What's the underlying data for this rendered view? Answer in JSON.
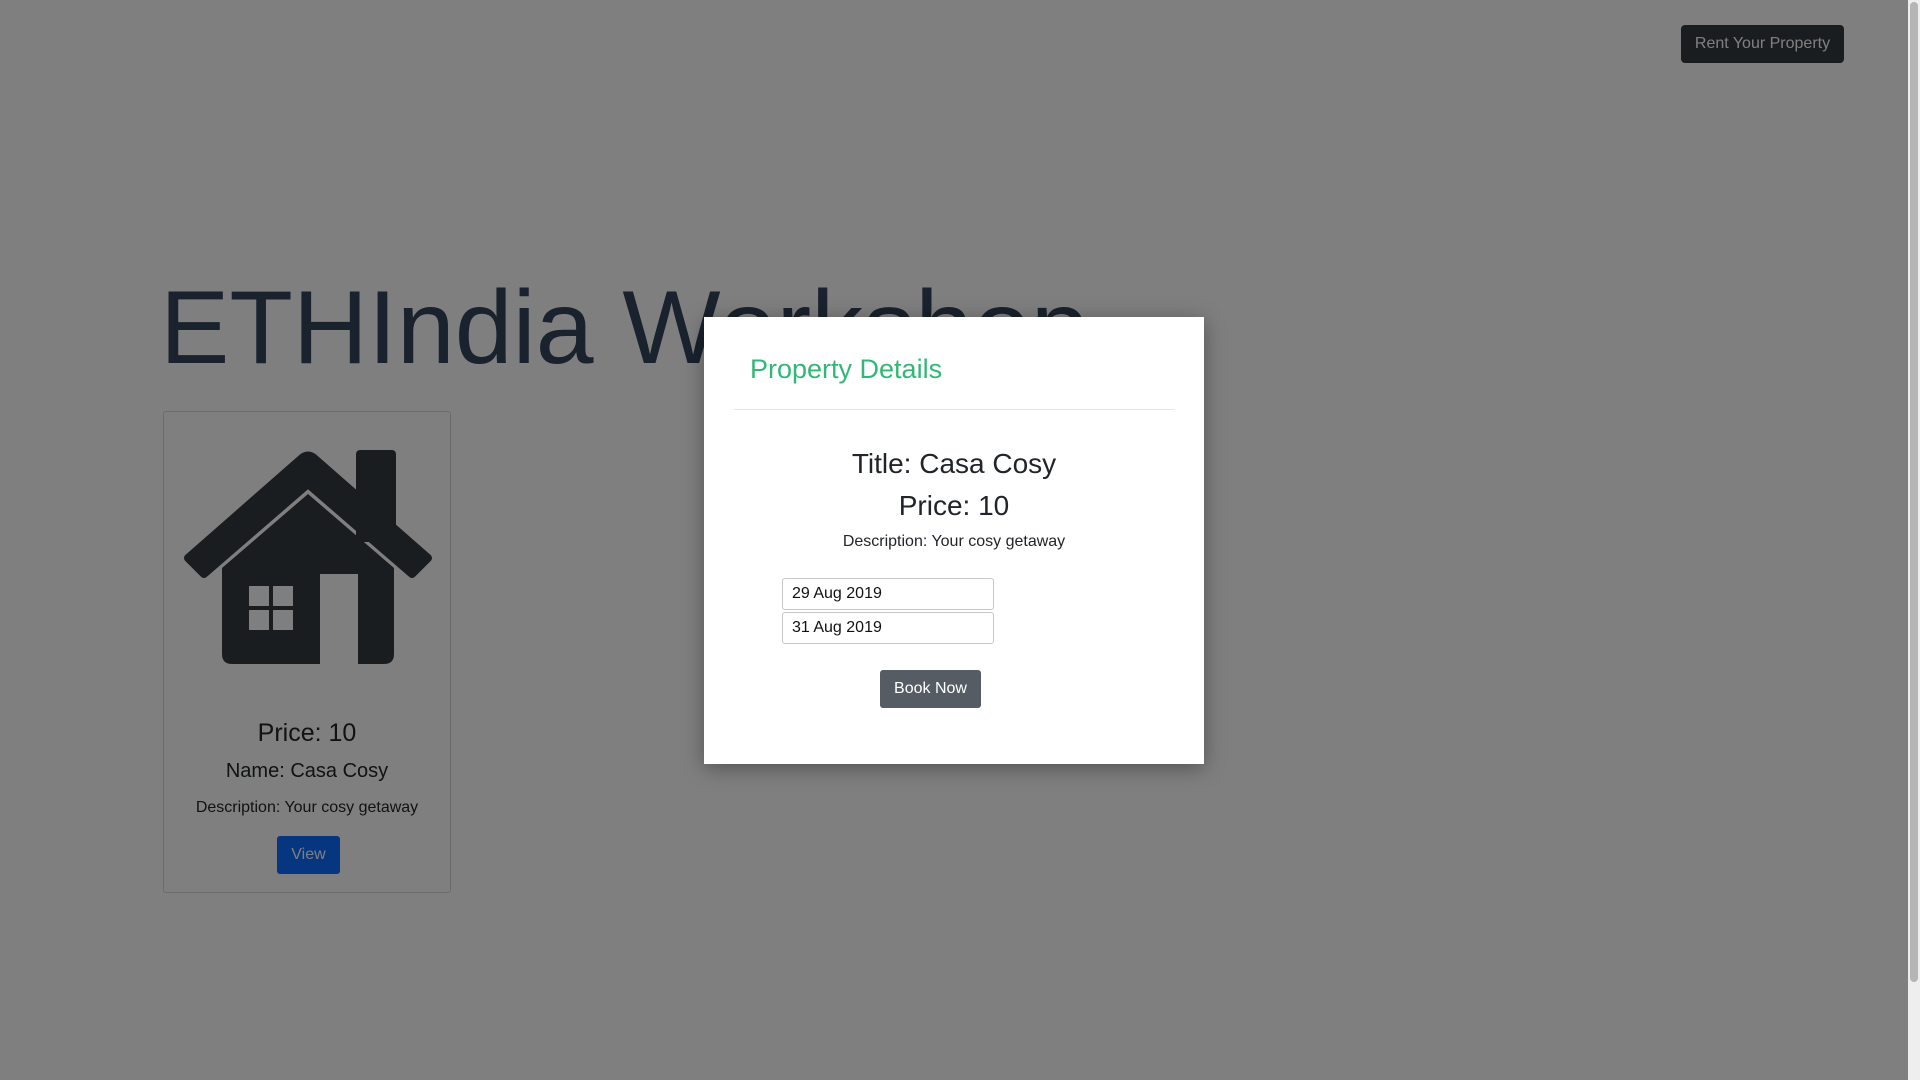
{
  "header": {
    "rent_button_label": "Rent Your Property"
  },
  "hero": {
    "title": "ETHIndia Workshop"
  },
  "listing_card": {
    "icon": "house-icon",
    "price_label": "Price: ",
    "price": "10",
    "name_label": "Name: ",
    "name": "Casa Cosy",
    "description_label": "Description: ",
    "description": "Your cosy getaway",
    "view_button_label": "View"
  },
  "modal": {
    "title": "Property Details",
    "title_label": "Title: ",
    "property_title": "Casa Cosy",
    "price_label": "Price: ",
    "price": "10",
    "description_label": "Description: ",
    "description": "Your cosy getaway",
    "start_date": "29 Aug 2019",
    "end_date": "31 Aug 2019",
    "book_button_label": "Book Now"
  },
  "colors": {
    "overlay": "rgba(0,0,0,0.5)",
    "modal_title": "#33b777",
    "dark_button": "#343a40",
    "primary_button": "#0a6cff",
    "hero_text": "#33445b"
  }
}
